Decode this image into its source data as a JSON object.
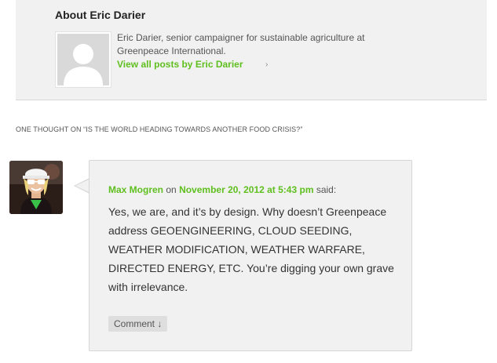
{
  "author_box": {
    "title": "About Eric Darier",
    "description": "Eric Darier, senior campaigner for sustainable agriculture at Greenpeace International.",
    "view_all_link": "View all posts by Eric Darier",
    "view_all_arrow": "›"
  },
  "comments": {
    "title": "ONE THOUGHT ON “IS THE WORLD HEADING TOWARDS ANOTHER FOOD CRISIS?”",
    "items": [
      {
        "author": "Max Mogren",
        "on_word": "on",
        "date": "November 20, 2012 at 5:43 pm",
        "said_word": "said:",
        "text": "Yes, we are, and it’s by design. Why doesn’t Greenpeace address GEOENGINEERING, CLOUD SEEDING, WEATHER MODIFICATION, WEATHER WARFARE, DIRECTED ENERGY, ETC. You’re digging your own grave with irrelevance.",
        "reply_label": "Comment ↓"
      }
    ]
  },
  "colors": {
    "link_green": "#5fbf1e",
    "box_background": "#f1f1f1"
  }
}
